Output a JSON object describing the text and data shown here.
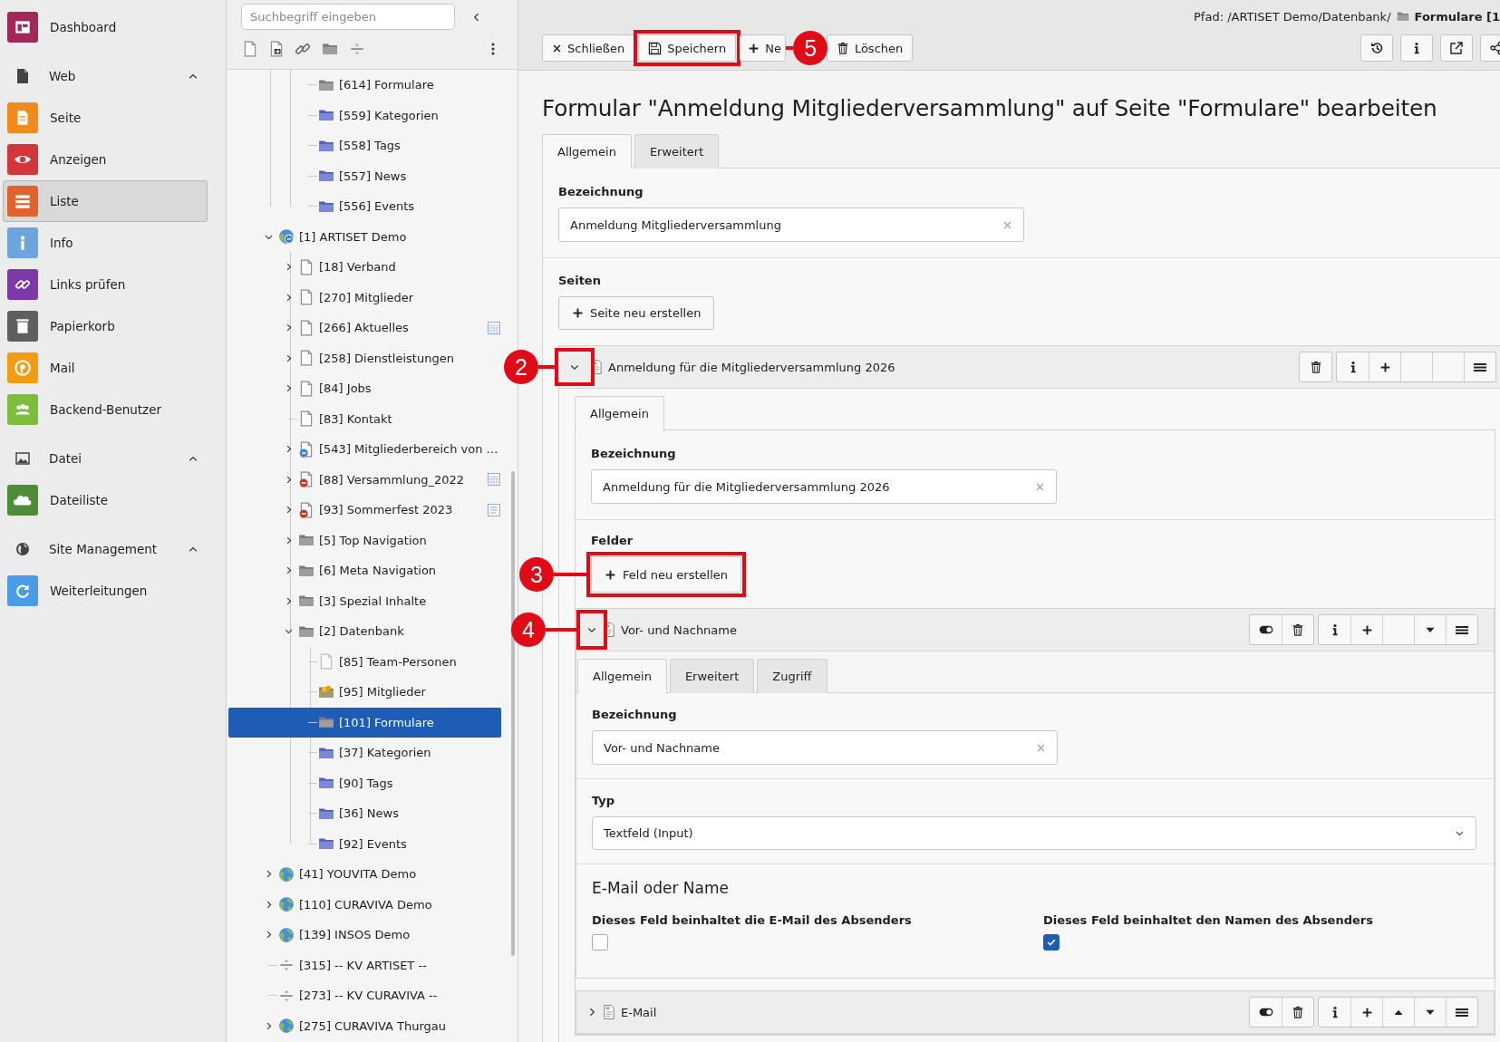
{
  "module_menu": [
    {
      "kind": "module",
      "label": "Dashboard",
      "color": "#a4275a",
      "selected": false
    },
    {
      "kind": "group",
      "label": "Web",
      "expanded": true
    },
    {
      "kind": "module",
      "label": "Seite",
      "color": "#f28b1e",
      "selected": false
    },
    {
      "kind": "module",
      "label": "Anzeigen",
      "color": "#d4373a",
      "selected": false
    },
    {
      "kind": "module",
      "label": "Liste",
      "color": "#e1622c",
      "selected": true
    },
    {
      "kind": "module",
      "label": "Info",
      "color": "#6ba5db",
      "selected": false
    },
    {
      "kind": "module",
      "label": "Links prüfen",
      "color": "#7d3aa6",
      "selected": false
    },
    {
      "kind": "module",
      "label": "Papierkorb",
      "color": "#5f5f5f",
      "selected": false
    },
    {
      "kind": "module",
      "label": "Mail",
      "color": "#f39c12",
      "selected": false
    },
    {
      "kind": "module",
      "label": "Backend-Benutzer",
      "color": "#7cbd3b",
      "selected": false
    },
    {
      "kind": "group",
      "label": "Datei",
      "expanded": true
    },
    {
      "kind": "module",
      "label": "Dateiliste",
      "color": "#4f8c3a",
      "selected": false
    },
    {
      "kind": "group",
      "label": "Site Management",
      "expanded": true
    },
    {
      "kind": "module",
      "label": "Weiterleitungen",
      "color": "#4a9be8",
      "selected": false
    }
  ],
  "page_tree": {
    "search": {
      "placeholder": "Suchbegriff eingeben"
    },
    "tree": [
      {
        "children": [
          {
            "children": [
              {
                "label": "[614] Formulare",
                "kind": "folder",
                "expandable": false,
                "selected": false
              },
              {
                "label": "[559] Kategorien",
                "kind": "folder-blue",
                "expandable": false,
                "selected": false
              },
              {
                "label": "[558] Tags",
                "kind": "folder-blue",
                "expandable": false,
                "selected": false
              },
              {
                "label": "[557] News",
                "kind": "folder-blue",
                "expandable": false,
                "selected": false
              },
              {
                "label": "[556] Events",
                "kind": "folder-blue",
                "expandable": false,
                "selected": false
              }
            ]
          }
        ]
      },
      {
        "label": "[1] ARTISET Demo",
        "kind": "site",
        "expandable": true,
        "expanded": true,
        "selected": false,
        "children": [
          {
            "label": "[18] Verband",
            "kind": "page",
            "expandable": true,
            "expanded": false,
            "selected": false
          },
          {
            "label": "[270] Mitglieder",
            "kind": "page",
            "expandable": true,
            "expanded": false,
            "selected": false
          },
          {
            "label": "[266] Aktuelles",
            "kind": "page",
            "expandable": true,
            "expanded": false,
            "selected": false,
            "side_icon": {
              "kind": "grid"
            }
          },
          {
            "label": "[258] Dienstleistungen",
            "kind": "page",
            "expandable": true,
            "expanded": false,
            "selected": false
          },
          {
            "label": "[84] Jobs",
            "kind": "page",
            "expandable": true,
            "expanded": false,
            "selected": false
          },
          {
            "label": "[83] Kontakt",
            "kind": "page",
            "expandable": false,
            "selected": false
          },
          {
            "label": "[543] Mitgliederbereich von …",
            "kind": "shortcut",
            "expandable": true,
            "expanded": false,
            "selected": false
          },
          {
            "label": "[88] Versammlung_2022",
            "kind": "hidden-page",
            "expandable": true,
            "expanded": false,
            "selected": false,
            "side_icon": {
              "kind": "grid"
            }
          },
          {
            "label": "[93] Sommerfest 2023",
            "kind": "hidden-page",
            "expandable": true,
            "expanded": false,
            "selected": false,
            "side_icon": {
              "kind": "sheet"
            }
          },
          {
            "label": "[5] Top Navigation",
            "kind": "folder",
            "expandable": true,
            "expanded": false,
            "selected": false
          },
          {
            "label": "[6] Meta Navigation",
            "kind": "folder",
            "expandable": true,
            "expanded": false,
            "selected": false
          },
          {
            "label": "[3] Spezial Inhalte",
            "kind": "folder",
            "expandable": true,
            "expanded": false,
            "selected": false
          },
          {
            "label": "[2] Datenbank",
            "kind": "folder",
            "expandable": true,
            "expanded": true,
            "selected": false,
            "children": [
              {
                "label": "[85] Team-Personen",
                "kind": "page-light",
                "expandable": false,
                "selected": false
              },
              {
                "label": "[95] Mitglieder",
                "kind": "folder-users",
                "expandable": false,
                "selected": false
              },
              {
                "label": "[101] Formulare",
                "kind": "folder",
                "expandable": false,
                "selected": true
              },
              {
                "label": "[37] Kategorien",
                "kind": "folder-blue",
                "expandable": false,
                "selected": false
              },
              {
                "label": "[90] Tags",
                "kind": "folder-blue",
                "expandable": false,
                "selected": false
              },
              {
                "label": "[36] News",
                "kind": "folder-blue",
                "expandable": false,
                "selected": false
              },
              {
                "label": "[92] Events",
                "kind": "folder-blue",
                "expandable": false,
                "selected": false
              }
            ]
          }
        ]
      },
      {
        "label": "[41] YOUVITA Demo",
        "kind": "globe",
        "expandable": true,
        "expanded": false,
        "selected": false
      },
      {
        "label": "[110] CURAVIVA Demo",
        "kind": "globe",
        "expandable": true,
        "expanded": false,
        "selected": false
      },
      {
        "label": "[139] INSOS Demo",
        "kind": "globe",
        "expandable": true,
        "expanded": false,
        "selected": false
      },
      {
        "label": "[315] -- KV ARTISET --",
        "kind": "separator",
        "expandable": false,
        "selected": false
      },
      {
        "label": "[273] -- KV CURAVIVA --",
        "kind": "separator",
        "expandable": false,
        "selected": false
      },
      {
        "label": "[275] CURAVIVA Thurgau",
        "kind": "globe",
        "expandable": true,
        "expanded": false,
        "selected": false
      }
    ]
  },
  "docheader": {
    "path_label": "Pfad: /ARTISET Demo/Datenbank/",
    "path_current": "Formulare [1",
    "buttons": [
      {
        "kind": "close",
        "label": "Schließen"
      },
      {
        "kind": "save",
        "label": "Speichern",
        "callout": "5"
      },
      {
        "kind": "new",
        "label": "Ne"
      },
      {
        "kind": "delete",
        "label": "Löschen"
      }
    ]
  },
  "title": "Formular \"Anmeldung Mitgliederversammlung\" auf Seite \"Formulare\" bearbeiten",
  "tabs": [
    {
      "label": "Allgemein",
      "selected": true
    },
    {
      "label": "Erweitert",
      "selected": false
    }
  ],
  "form": {
    "name_label": "Bezeichnung",
    "name_value": "Anmeldung Mitgliederversammlung",
    "pages_label": "Seiten",
    "new_page_button": "Seite neu erstellen",
    "pages": [
      {
        "title": "Anmeldung für die Mitgliederversammlung 2026",
        "expanded": true,
        "callout": "2",
        "hide_toggle": false,
        "can_move_up": false,
        "can_move_down": false,
        "tabs": [
          {
            "label": "Allgemein",
            "selected": true
          }
        ],
        "name_label": "Bezeichnung",
        "name_value": "Anmeldung für die Mitgliederversammlung 2026",
        "fields_label": "Felder",
        "new_field_button": {
          "label": "Feld neu erstellen",
          "callout": "3"
        },
        "fields": [
          {
            "title": "Vor- und Nachname",
            "expanded": true,
            "callout": "4",
            "hide_toggle": true,
            "can_move_up": false,
            "can_move_down": true,
            "tabs": [
              {
                "label": "Allgemein",
                "selected": true
              },
              {
                "label": "Erweitert",
                "selected": false
              },
              {
                "label": "Zugriff",
                "selected": false
              }
            ],
            "name_label": "Bezeichnung",
            "name_value": "Vor- und Nachname",
            "type_label": "Typ",
            "type_value": "Textfeld (Input)",
            "section_title": "E-Mail oder Name",
            "checkboxes": [
              {
                "label": "Dieses Feld beinhaltet die E-Mail des Absenders",
                "checked": false
              },
              {
                "label": "Dieses Feld beinhaltet den Namen des Absenders",
                "checked": true
              }
            ]
          },
          {
            "title": "E-Mail",
            "expanded": false,
            "hide_toggle": true,
            "can_move_up": true,
            "can_move_down": true
          }
        ]
      }
    ]
  }
}
